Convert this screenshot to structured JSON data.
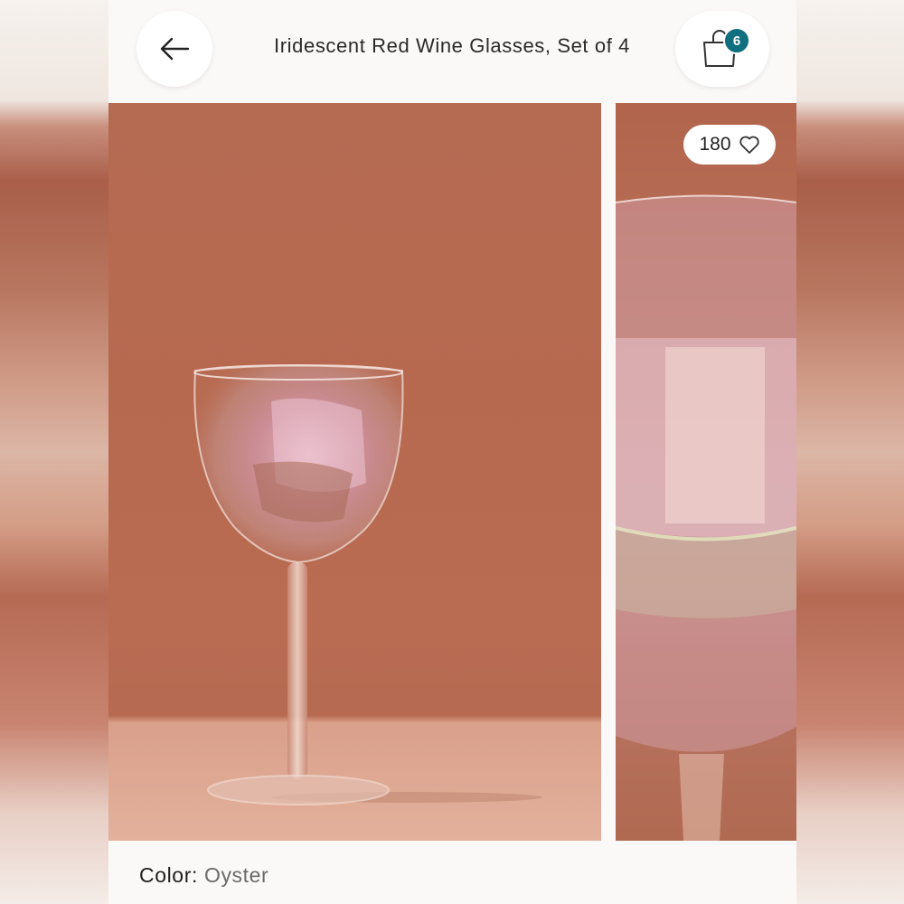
{
  "header": {
    "title": "Iridescent Red Wine Glasses, Set of 4",
    "back_icon": "arrow-left-icon",
    "bag_icon": "shopping-bag-icon",
    "bag_count": "6"
  },
  "gallery": {
    "likes_count": "180",
    "likes_icon": "heart-outline-icon"
  },
  "product": {
    "color_label": "Color:",
    "color_value": "Oyster"
  },
  "colors": {
    "badge": "#0f6f7f",
    "background_terracotta": "#b7694f"
  }
}
